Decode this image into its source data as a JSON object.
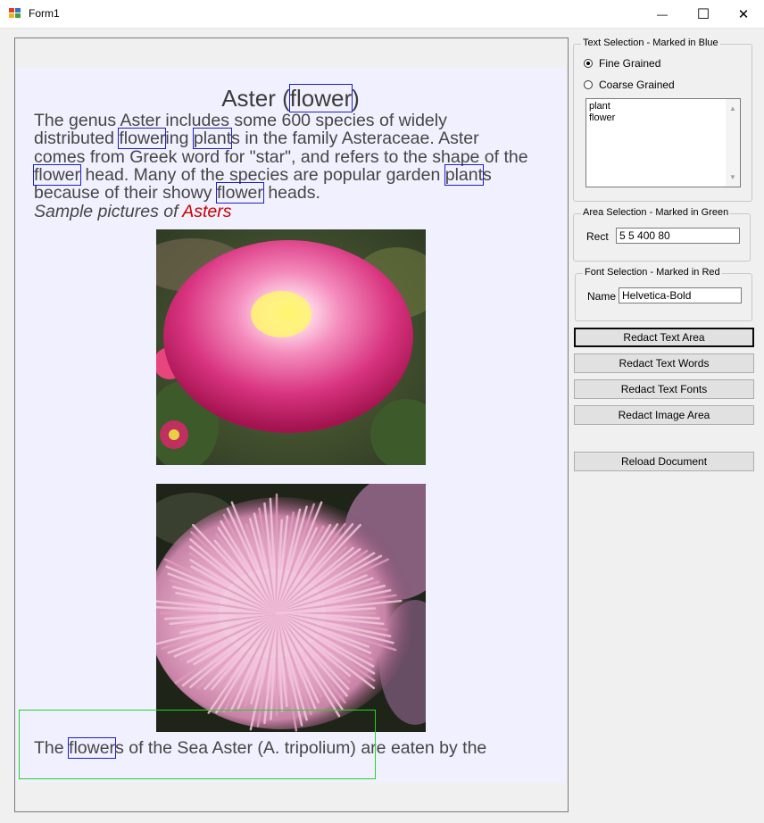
{
  "window": {
    "title": "Form1",
    "minimize_glyph": "—",
    "maximize_glyph": "☐",
    "close_glyph": "✕",
    "icon": "winforms-app-icon"
  },
  "document": {
    "title_before": "Aster (",
    "title_mark": "flower",
    "title_after": ")",
    "para_line1": "The genus Aster includes some 600 species of widely",
    "para_line2_a": "distributed ",
    "para_line2_mark1": "flower",
    "para_line2_b": "ing ",
    "para_line2_mark2": "plant",
    "para_line2_c": "s in the family Asteraceae. Aster",
    "para_line3": "comes from Greek word for \"star\", and refers to the shape of the",
    "para_line4_mark1": "flower",
    "para_line4_a": " head. Many of the species are popular garden ",
    "para_line4_mark2": "plant",
    "para_line4_b": "s",
    "para_line5_a": "because of their showy ",
    "para_line5_mark": "flower",
    "para_line5_b": " heads.",
    "caption_a": "Sample pictures of ",
    "caption_b": "Asters",
    "bottom_a": "The ",
    "bottom_mark": "flower",
    "bottom_b": "s of the Sea Aster (A. tripolium) are eaten by the",
    "colors": {
      "page_bg": "#f0f0ff",
      "text": "#464646",
      "word_mark": "#1e1ec8",
      "area_mark": "#23d323",
      "caption_red": "#cc0000"
    }
  },
  "panel": {
    "text_selection": {
      "legend": "Text Selection - Marked in Blue",
      "fine_label": "Fine Grained",
      "coarse_label": "Coarse Grained",
      "selected": "Fine Grained",
      "words": [
        "plant",
        "flower"
      ]
    },
    "area_selection": {
      "legend": "Area Selection - Marked in Green",
      "rect_label": "Rect",
      "rect_value": "5 5 400 80"
    },
    "font_selection": {
      "legend": "Font Selection - Marked in Red",
      "name_label": "Name",
      "name_value": "Helvetica-Bold"
    },
    "buttons": {
      "redact_text_area": "Redact Text Area",
      "redact_text_words": "Redact Text Words",
      "redact_text_fonts": "Redact Text Fonts",
      "redact_image_area": "Redact Image Area",
      "reload_document": "Reload Document"
    }
  }
}
